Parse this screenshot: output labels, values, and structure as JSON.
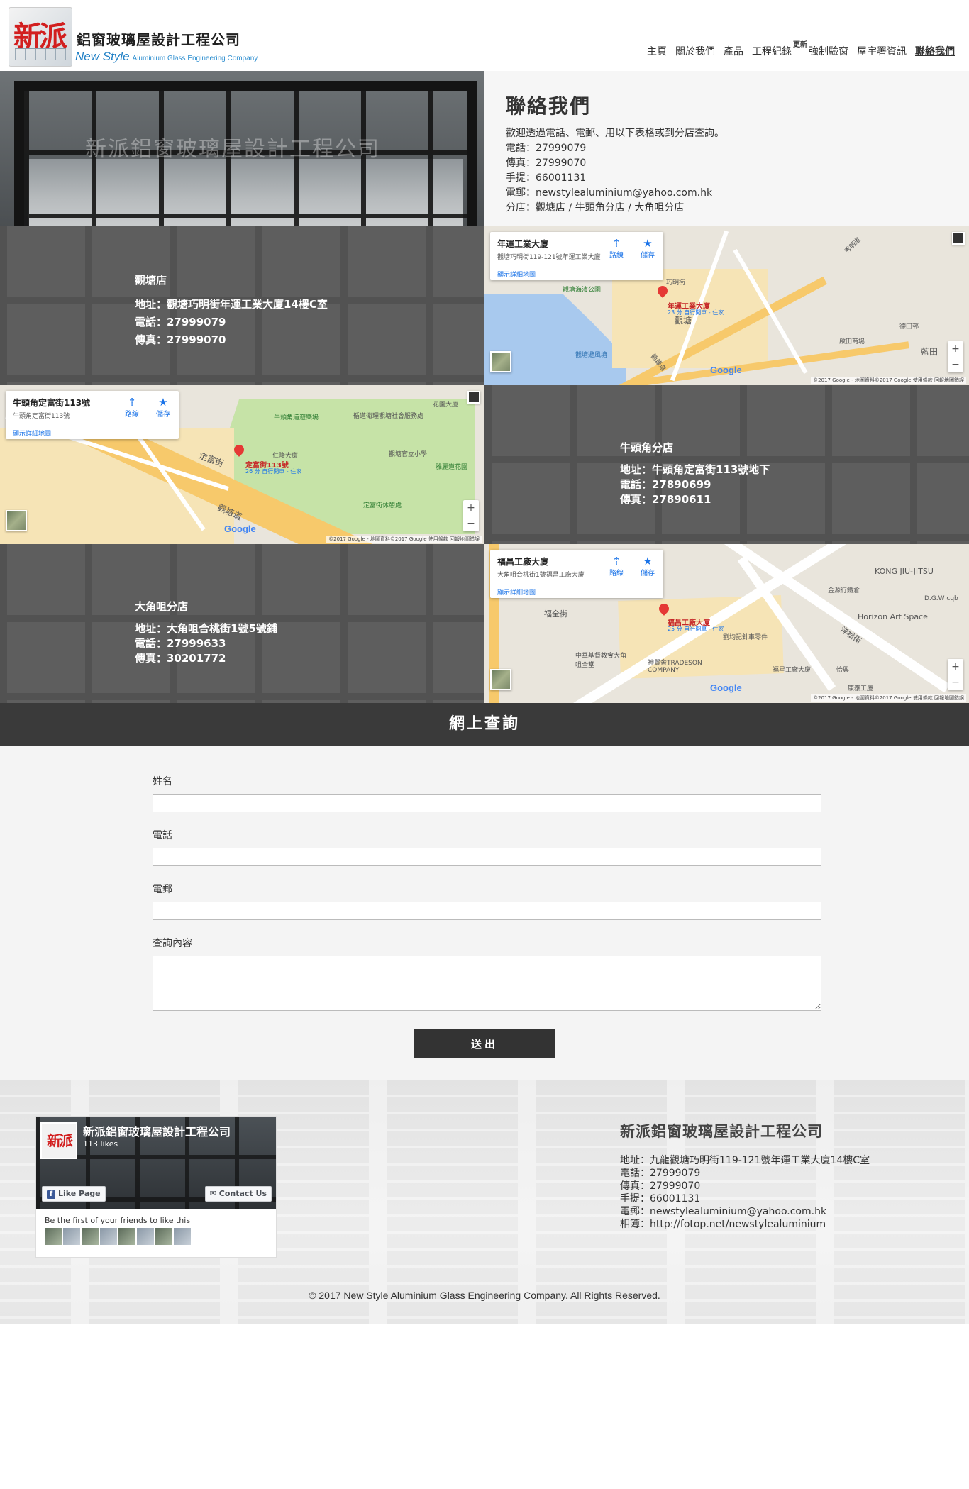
{
  "brand": {
    "logo_glyph": "新派",
    "name_cn": "鋁窗玻璃屋設計工程公司",
    "name_en": "New Style",
    "name_en_small": "Aluminium Glass Engineering Company"
  },
  "nav": {
    "items": [
      "主頁",
      "關於我們",
      "產品",
      "工程紀錄",
      "強制驗窗",
      "屋宇署資訊",
      "聯絡我們"
    ],
    "badge": "更新",
    "active_index": 6
  },
  "hero": {
    "watermark": "新派鋁窗玻璃屋設計工程公司",
    "title": "聯絡我們",
    "lines": [
      "歡迎透過電話、電郵、用以下表格或到分店查詢。",
      "電話：27999079",
      "傳真：27999070",
      "手提：66001131",
      "電郵：newstylealuminium@yahoo.com.hk",
      "分店：觀塘店 / 牛頭角分店 / 大角咀分店"
    ]
  },
  "branches": [
    {
      "name": "觀塘店",
      "address": "地址：觀塘巧明街年運工業大廈14樓C室",
      "phone": "電話：27999079",
      "fax": "傳真：27999070",
      "map": {
        "card_title": "年運工業大廈",
        "card_address": "觀塘巧明街119-121號年運工業大廈",
        "card_link": "顯示詳細地圖",
        "pin_label": "年運工業大廈",
        "pin_sub": "23 分 自行開車 - 住家",
        "labels": [
          "觀塘海濱公園",
          "觀塘",
          "巧明街",
          "觀塘避風塘",
          "啟田商場",
          "藍田",
          "觀塘道",
          "德田邨",
          "秀明道"
        ],
        "attribution": "©2017 Google - 地圖資料©2017 Google   使用條款   回報地圖錯誤"
      }
    },
    {
      "name": "牛頭角分店",
      "address": "地址：牛頭角定富街113號地下",
      "phone": "電話：27890699",
      "fax": "傳真：27890611",
      "map": {
        "card_title": "牛頭角定富街113號",
        "card_address": "牛頭角定富街113號",
        "card_link": "顯示詳細地圖",
        "pin_label": "定富街113號",
        "pin_sub": "26 分 自行開車 - 住家",
        "labels": [
          "牛頭角道遊樂場",
          "循道衛理觀塘社會服務處",
          "觀塘官立小學",
          "雅麗道花園",
          "定富街休憩處",
          "觀塘道",
          "花園大廈",
          "定富街",
          "仁隆大廈"
        ],
        "attribution": "©2017 Google - 地圖資料©2017 Google   使用條款   回報地圖錯誤"
      }
    },
    {
      "name": "大角咀分店",
      "address": "地址：大角咀合桃街1號5號鋪",
      "phone": "電話：27999633",
      "fax": "傳真：30201772",
      "map": {
        "card_title": "福昌工廠大廈",
        "card_address": "大角咀合桃街1號福昌工廠大廈",
        "card_link": "顯示詳細地圖",
        "pin_label": "福昌工廠大廈",
        "pin_sub": "25 分 自行開車 - 住家",
        "labels": [
          "KONG JIU-JITSU",
          "金源行鐵倉",
          "D.G.W cqb",
          "Horizon Art Space",
          "劉均記針車零件",
          "中華基督教會大角咀全堂",
          "神貿舍TRADESON COMPANY",
          "福星工廠大廈",
          "怡興",
          "福全街",
          "洋松街",
          "康泰工廈"
        ],
        "attribution": "©2017 Google - 地圖資料©2017 Google   使用條款   回報地圖錯誤"
      }
    }
  ],
  "map_actions": {
    "route": "路線",
    "save": "儲存"
  },
  "map_logo": "Google",
  "enquiry": {
    "title": "網上查詢",
    "fields": [
      {
        "label": "姓名",
        "value": ""
      },
      {
        "label": "電話",
        "value": ""
      },
      {
        "label": "電郵",
        "value": ""
      }
    ],
    "message_label": "查詢內容",
    "submit": "送出"
  },
  "facebook": {
    "page_name": "新派鋁窗玻璃屋設計工程公司",
    "likes": "113 likes",
    "like_button": "Like Page",
    "contact_button": "Contact Us",
    "friends_text": "Be the first of your friends to like this"
  },
  "company": {
    "title": "新派鋁窗玻璃屋設計工程公司",
    "lines": [
      "地址：九龍觀塘巧明街119-121號年運工業大廈14樓C室",
      "電話：27999079",
      "傳真：27999070",
      "手提：66001131",
      "電郵：newstylealuminium@yahoo.com.hk",
      "相簿：http://fotop.net/newstylealuminium"
    ]
  },
  "copyright": "© 2017 New Style Aluminium Glass Engineering Company. All Rights Reserved."
}
